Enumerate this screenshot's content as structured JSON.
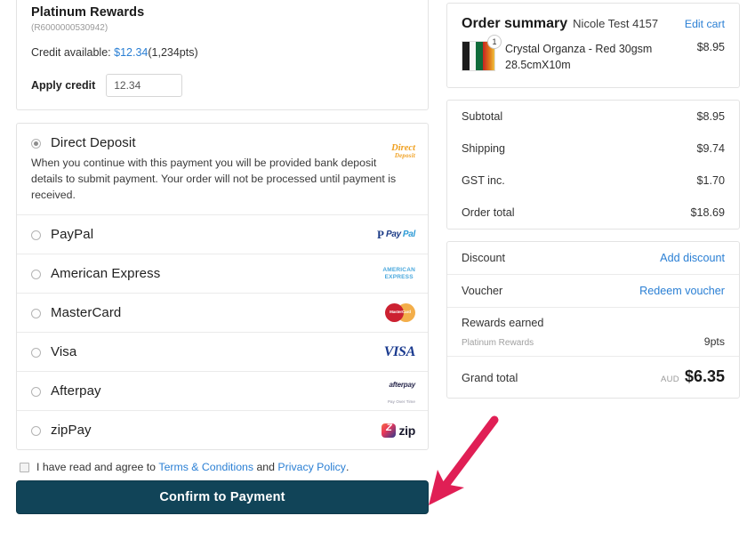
{
  "rewards": {
    "title": "Platinum Rewards",
    "account": "(R6000000530942)",
    "credit_label": "Credit available:",
    "credit_amount": "$12.34",
    "credit_points": "(1,234pts)",
    "apply_label": "Apply credit",
    "apply_value": "12.34",
    "link_color": "#2a7fd4"
  },
  "payment_methods": [
    {
      "label": "Direct Deposit",
      "selected": true,
      "description": "When you continue with this payment you will be provided bank deposit details to submit payment. Your order will not be processed until payment is received.",
      "logo": "direct-deposit-logo",
      "logo_line1": "Direct",
      "logo_line2": "Deposit"
    },
    {
      "label": "PayPal",
      "selected": false,
      "logo": "paypal-logo"
    },
    {
      "label": "American Express",
      "selected": false,
      "logo": "amex-logo",
      "logo_line1": "AMERICAN",
      "logo_line2": "EXPRESS"
    },
    {
      "label": "MasterCard",
      "selected": false,
      "logo": "mastercard-logo",
      "logo_line1": "MasterCard"
    },
    {
      "label": "Visa",
      "selected": false,
      "logo": "visa-logo",
      "logo_line1": "VISA"
    },
    {
      "label": "Afterpay",
      "selected": false,
      "logo": "afterpay-logo",
      "logo_line1": "afterpay",
      "logo_line2": "Pay Over Time"
    },
    {
      "label": "zipPay",
      "selected": false,
      "logo": "zip-logo",
      "logo_line1": "zip"
    }
  ],
  "terms": {
    "prefix": "I have read and agree to",
    "terms_link": "Terms & Conditions",
    "conjunction": "and",
    "privacy_link": "Privacy Policy",
    "suffix": ".",
    "checked": false
  },
  "confirm_button": {
    "label": "Confirm to Payment",
    "background": "#114458",
    "text_color": "#ffffff"
  },
  "order_summary": {
    "title": "Order summary",
    "customer": "Nicole Test 4157",
    "edit_cart": "Edit cart",
    "item": {
      "name": "Crystal Organza - Red 30gsm 28.5cmX10m",
      "price": "$8.95",
      "quantity": "1"
    },
    "totals": [
      {
        "label": "Subtotal",
        "value": "$8.95"
      },
      {
        "label": "Shipping",
        "value": "$9.74"
      },
      {
        "label": "GST inc.",
        "value": "$1.70"
      },
      {
        "label": "Order total",
        "value": "$18.69"
      }
    ],
    "discount": {
      "label": "Discount",
      "action": "Add discount"
    },
    "voucher": {
      "label": "Voucher",
      "action": "Redeem voucher"
    },
    "rewards_earned": {
      "label": "Rewards earned",
      "program": "Platinum Rewards",
      "points": "9pts"
    },
    "grand_total": {
      "label": "Grand total",
      "currency": "AUD",
      "amount": "$6.35"
    }
  },
  "annotation": {
    "arrow_color": "#e01f55",
    "points_to": "confirm-to-payment-button"
  }
}
